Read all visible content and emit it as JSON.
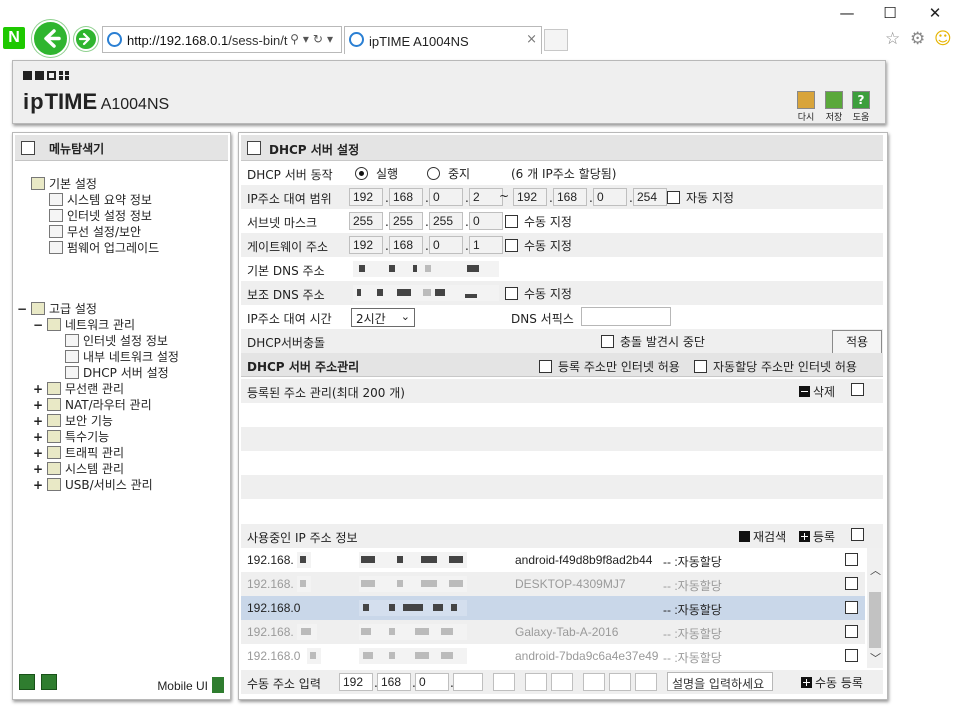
{
  "browser": {
    "url_host": "http://192.168.0.1",
    "url_path": "/sess-bin/t",
    "tab_title": "ipTIME A1004NS",
    "tab_close": "×",
    "min": "—",
    "max": "☐",
    "close": "✕"
  },
  "header": {
    "logo_ip": "ip",
    "logo_time": "TIME",
    "logo_model": " A1004NS",
    "buttons": [
      {
        "label": "다시",
        "color": "#d8a43a"
      },
      {
        "label": "저장",
        "color": "#5aa83a"
      },
      {
        "label": "도움",
        "color": "#3d9f3d"
      }
    ]
  },
  "menu": {
    "title": "메뉴탐색기",
    "basic": {
      "label": "기본 설정",
      "items": [
        "시스템 요약 정보",
        "인터넷 설정 정보",
        "무선 설정/보안",
        "펌웨어 업그레이드"
      ]
    },
    "advanced": {
      "label": "고급 설정",
      "expander": "−",
      "network": {
        "label": "네트워크 관리",
        "expander": "−",
        "items": [
          "인터넷 설정 정보",
          "내부 네트워크 설정",
          "DHCP 서버 설정"
        ]
      },
      "others": [
        "무선랜 관리",
        "NAT/라우터 관리",
        "보안 기능",
        "특수기능",
        "트래픽 관리",
        "시스템 관리",
        "USB/서비스 관리"
      ],
      "expander_plus": "+"
    },
    "mobile_ui": "Mobile UI"
  },
  "dhcp": {
    "title": "DHCP 서버 설정",
    "operation": {
      "label": "DHCP 서버 동작",
      "on": "실행",
      "off": "중지",
      "status": "(6 개 IP주소 할당됨)"
    },
    "range": {
      "label": "IP주소 대여 범위",
      "start": [
        "192",
        "168",
        "0",
        "2"
      ],
      "tilde": "~",
      "end": [
        "192",
        "168",
        "0",
        "254"
      ],
      "auto": "자동 지정"
    },
    "subnet": {
      "label": "서브넷 마스크",
      "value": [
        "255",
        "255",
        "255",
        "0"
      ],
      "manual": "수동 지정"
    },
    "gateway": {
      "label": "게이트웨이 주소",
      "value": [
        "192",
        "168",
        "0",
        "1"
      ],
      "manual": "수동 지정"
    },
    "dns1": {
      "label": "기본 DNS 주소"
    },
    "dns2": {
      "label": "보조 DNS 주소",
      "manual": "수동 지정"
    },
    "lease": {
      "label": "IP주소 대여 시간",
      "value": "2시간",
      "dns_suffix": "DNS 서픽스"
    },
    "conflict": {
      "label": "DHCP서버충돌",
      "stop": "충돌 발견시 중단",
      "apply": "적용"
    },
    "dot": "."
  },
  "address_mgmt": {
    "title": "DHCP 서버 주소관리",
    "registered_only": "등록 주소만 인터넷 허용",
    "auto_only": "자동할당 주소만 인터넷 허용",
    "registered": {
      "label": "등록된 주소 관리(최대 200 개)",
      "delete": "삭제"
    },
    "in_use": {
      "label": "사용중인 IP 주소 정보",
      "rescan": "재검색",
      "register": "등록"
    },
    "rows": [
      {
        "ip": "192.168.",
        "name": "android-f49d8b9f8ad2b44",
        "type": "-- :자동할당"
      },
      {
        "ip": "192.168.",
        "name": "DESKTOP-4309MJ7",
        "type": "-- :자동할당"
      },
      {
        "ip": "192.168.0",
        "name": "",
        "type": "-- :자동할당"
      },
      {
        "ip": "192.168.",
        "name": "Galaxy-Tab-A-2016",
        "type": "-- :자동할당"
      },
      {
        "ip": "192.168.0",
        "name": "android-7bda9c6a4e37e49",
        "type": "-- :자동할당"
      }
    ],
    "manual": {
      "label": "수동 주소 입력",
      "ip": [
        "192",
        "168",
        "0"
      ],
      "desc_placeholder": "설명을 입력하세요",
      "register": "수동 등록"
    }
  }
}
